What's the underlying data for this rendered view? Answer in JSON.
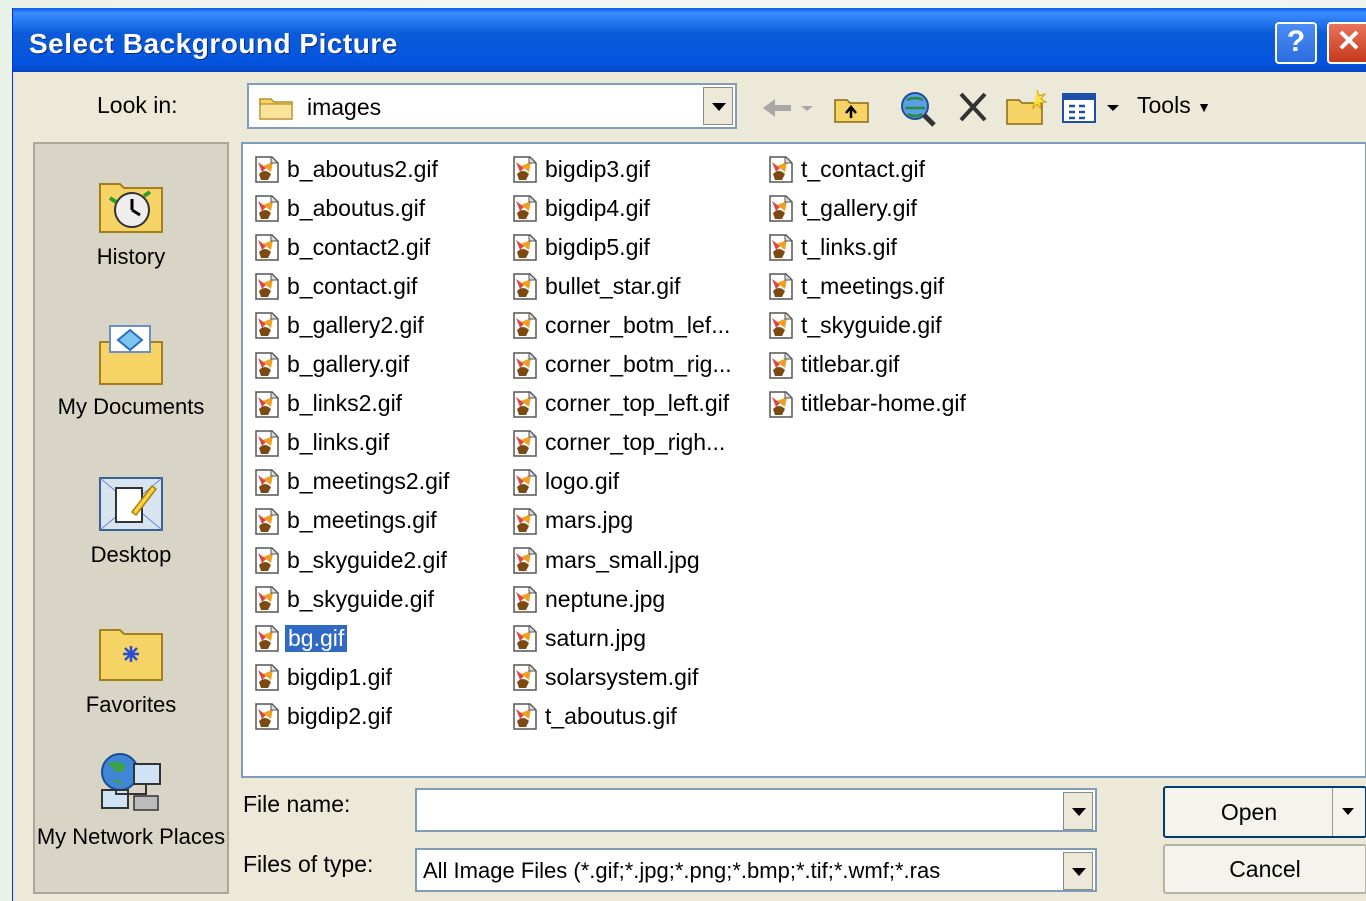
{
  "window": {
    "title": "Select Background Picture",
    "help_label": "?",
    "close_label": "✕"
  },
  "toolbar": {
    "look_in_label": "Look in:",
    "look_in_value": "images",
    "tools_label": "Tools",
    "icons": [
      "back-arrow-icon",
      "up-folder-icon",
      "search-web-icon",
      "delete-icon",
      "new-folder-icon",
      "views-icon"
    ]
  },
  "places": [
    {
      "label": "History",
      "icon": "history-icon"
    },
    {
      "label": "My Documents",
      "icon": "my-documents-icon"
    },
    {
      "label": "Desktop",
      "icon": "desktop-icon"
    },
    {
      "label": "Favorites",
      "icon": "favorites-icon"
    },
    {
      "label": "My Network Places",
      "icon": "network-places-icon"
    }
  ],
  "files": {
    "columns": [
      [
        "b_aboutus2.gif",
        "b_aboutus.gif",
        "b_contact2.gif",
        "b_contact.gif",
        "b_gallery2.gif",
        "b_gallery.gif",
        "b_links2.gif",
        "b_links.gif",
        "b_meetings2.gif",
        "b_meetings.gif",
        "b_skyguide2.gif",
        "b_skyguide.gif",
        "bg.gif",
        "bigdip1.gif",
        "bigdip2.gif"
      ],
      [
        "bigdip3.gif",
        "bigdip4.gif",
        "bigdip5.gif",
        "bullet_star.gif",
        "corner_botm_lef...",
        "corner_botm_rig...",
        "corner_top_left.gif",
        "corner_top_righ...",
        "logo.gif",
        "mars.jpg",
        "mars_small.jpg",
        "neptune.jpg",
        "saturn.jpg",
        "solarsystem.gif",
        "t_aboutus.gif"
      ],
      [
        "t_contact.gif",
        "t_gallery.gif",
        "t_links.gif",
        "t_meetings.gif",
        "t_skyguide.gif",
        "titlebar.gif",
        "titlebar-home.gif"
      ]
    ],
    "selected": "bg.gif"
  },
  "footer": {
    "file_name_label": "File name:",
    "file_name_value": "",
    "file_type_label": "Files of type:",
    "file_type_value": "All Image Files (*.gif;*.jpg;*.png;*.bmp;*.tif;*.wmf;*.ras",
    "open_label": "Open",
    "cancel_label": "Cancel"
  },
  "colors": {
    "titlebar": "#0554e0",
    "selection": "#316ac5",
    "dialog_bg": "#ece9d8"
  }
}
